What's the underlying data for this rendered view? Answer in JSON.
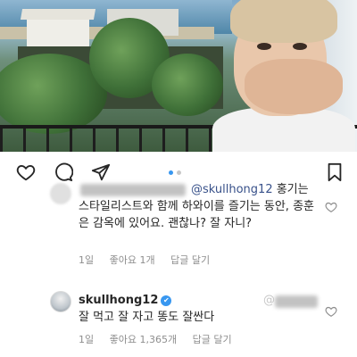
{
  "post": {
    "carousel": {
      "count": 2,
      "active": 1
    }
  },
  "comments": [
    {
      "username_visible": "@skullhong12",
      "mention_handle": "@skullhong12",
      "text_after_mention": " 홍기는 스타일리스트와 함께 하와이를 즐기는 동안, 종훈은 감옥에 있어요. 괜찮나? 잘 자니?",
      "time": "1일",
      "likes": "좋아요 1개",
      "reply": "답글 달기"
    },
    {
      "username": "skullhong12",
      "verified": "✔",
      "mention_tail": "@",
      "text": "잘 먹고 잘 자고 똥도 잘싼다",
      "time": "1일",
      "likes": "좋아요 1,365개",
      "reply": "답글 달기"
    }
  ],
  "icons": {
    "like": "heart-icon",
    "comment": "comment-bubble-icon",
    "share": "paper-plane-icon",
    "save": "bookmark-icon",
    "comment_like": "small-heart-icon"
  },
  "colors": {
    "text": "#262626",
    "meta": "#8e8e8e",
    "mention": "#38518a",
    "carousel_active": "#3897f0",
    "carousel_inactive": "#c7c7c7"
  }
}
